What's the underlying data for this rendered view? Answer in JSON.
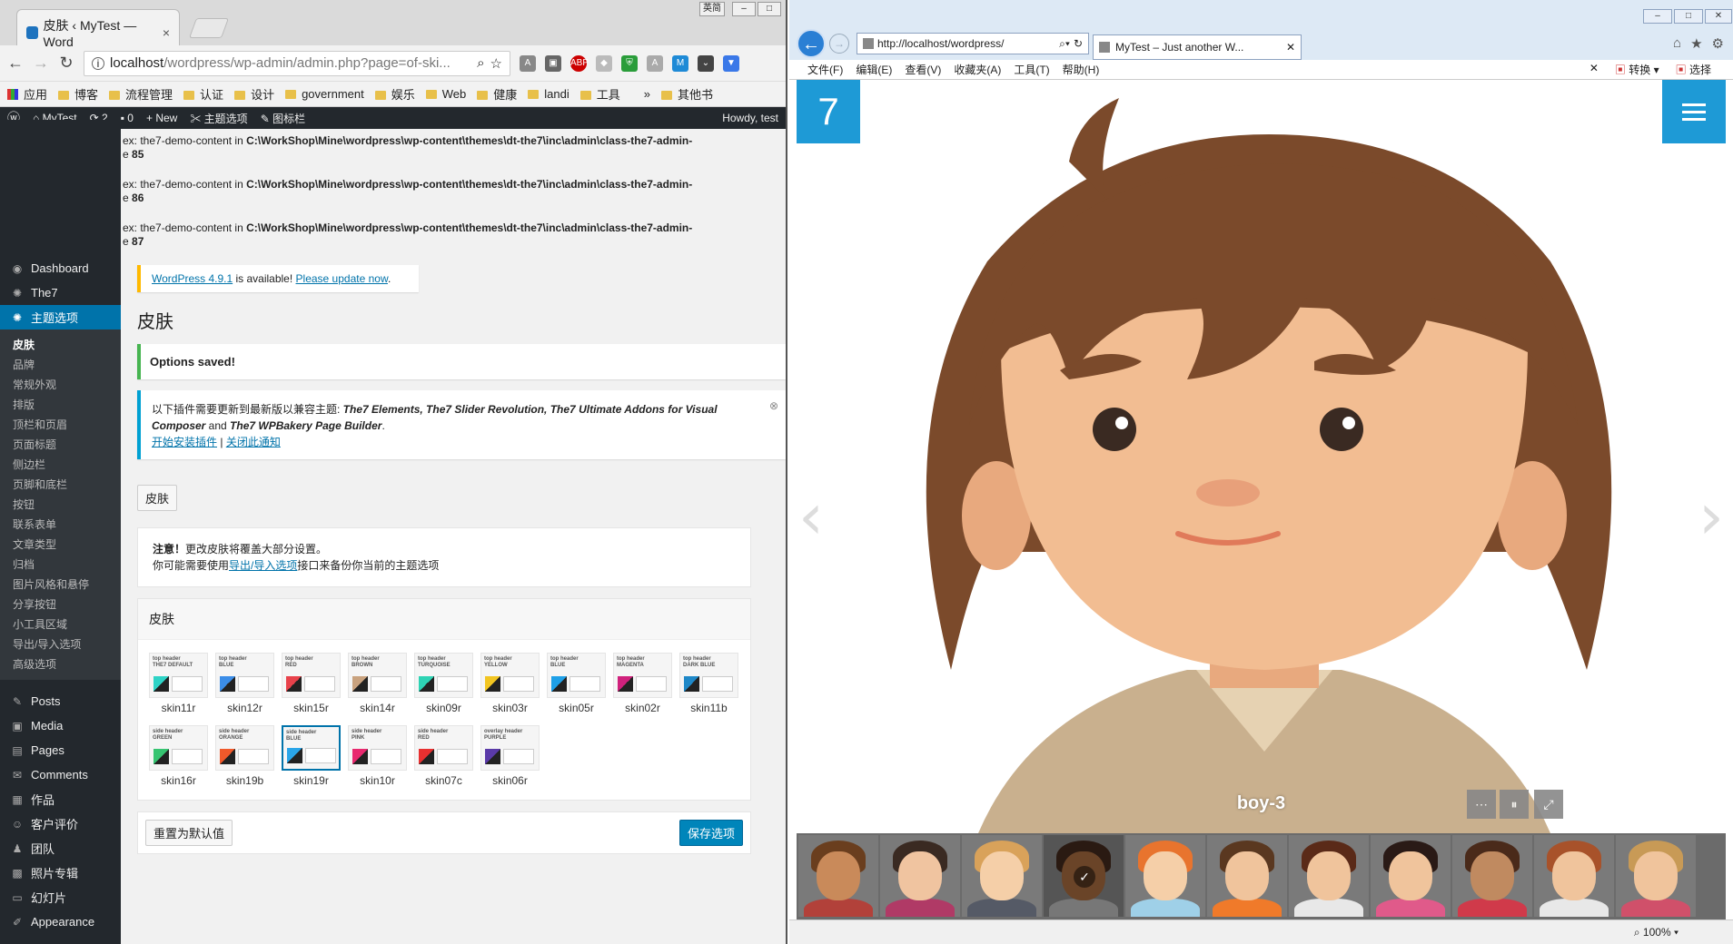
{
  "chrome": {
    "tab_title": "皮肤 ‹ MyTest — Word",
    "url_host": "localhost",
    "url_path": "/wordpress/wp-admin/admin.php?page=of-ski...",
    "ime": "英简",
    "bookmarks": [
      "应用",
      "博客",
      "流程管理",
      "认证",
      "设计",
      "government",
      "娱乐",
      "Web",
      "健康",
      "landi",
      "工具",
      "其他书"
    ],
    "more": "»"
  },
  "adminbar": {
    "site": "MyTest",
    "updates": "2",
    "comments": "0",
    "new": "New",
    "theme_options": "主题选项",
    "iconbar": "图标栏",
    "howdy": "Howdy, test"
  },
  "sidebar": {
    "top": [
      {
        "icon": "◉",
        "label": "Dashboard"
      },
      {
        "icon": "✺",
        "label": "The7"
      },
      {
        "icon": "✺",
        "label": "主题选项"
      }
    ],
    "sub": [
      "皮肤",
      "品牌",
      "常规外观",
      "排版",
      "顶栏和页眉",
      "页面标题",
      "侧边栏",
      "页脚和底栏",
      "按钮",
      "联系表单",
      "文章类型",
      "归档",
      "图片风格和悬停",
      "分享按钮",
      "小工具区域",
      "导出/导入选项",
      "高级选项"
    ],
    "bottom": [
      {
        "icon": "✎",
        "label": "Posts"
      },
      {
        "icon": "▣",
        "label": "Media"
      },
      {
        "icon": "▤",
        "label": "Pages"
      },
      {
        "icon": "✉",
        "label": "Comments"
      },
      {
        "icon": "▦",
        "label": "作品"
      },
      {
        "icon": "☺",
        "label": "客户评价"
      },
      {
        "icon": "♟",
        "label": "团队"
      },
      {
        "icon": "▩",
        "label": "照片专辑"
      },
      {
        "icon": "▭",
        "label": "幻灯片"
      },
      {
        "icon": "✐",
        "label": "Appearance"
      }
    ]
  },
  "errors": [
    {
      "prefix": "ex: the7-demo-content in ",
      "path": "C:\\WorkShop\\Mine\\wordpress\\wp-content\\themes\\dt-the7\\inc\\admin\\class-the7-admin-",
      "line_prefix": "e ",
      "line": "85"
    },
    {
      "prefix": "ex: the7-demo-content in ",
      "path": "C:\\WorkShop\\Mine\\wordpress\\wp-content\\themes\\dt-the7\\inc\\admin\\class-the7-admin-",
      "line_prefix": "e ",
      "line": "86"
    },
    {
      "prefix": "ex: the7-demo-content in ",
      "path": "C:\\WorkShop\\Mine\\wordpress\\wp-content\\themes\\dt-the7\\inc\\admin\\class-the7-admin-",
      "line_prefix": "e ",
      "line": "87"
    }
  ],
  "update_notice": {
    "version_link": "WordPress 4.9.1",
    "text": " is available! ",
    "update_link": "Please update now",
    "end": "."
  },
  "page_title": "皮肤",
  "saved_notice": "Options saved!",
  "plugin_notice": {
    "intro": "以下插件需要更新到最新版以兼容主题: ",
    "plugins": "The7 Elements, The7 Slider Revolution, The7 Ultimate Addons for Visual Composer",
    "and": " and ",
    "last": "The7 WPBakery Page Builder",
    "end": ".",
    "link1": "开始安装插件",
    "sep": " | ",
    "link2": "关闭此通知"
  },
  "section_button": "皮肤",
  "warning": {
    "bold": "注意！",
    "line1": "更改皮肤将覆盖大部分设置。",
    "line2_pre": "你可能需要使用",
    "line2_link": "导出/导入选项",
    "line2_post": "接口来备份你当前的主题选项"
  },
  "skins_title": "皮肤",
  "skins": [
    {
      "name": "skin11r",
      "t1": "top header",
      "t2": "THE7 DEFAULT",
      "color": "#2ed3c6",
      "selected": false
    },
    {
      "name": "skin12r",
      "t1": "top header",
      "t2": "BLUE",
      "color": "#3b8de8",
      "selected": false
    },
    {
      "name": "skin15r",
      "t1": "top header",
      "t2": "RED",
      "color": "#e8424b",
      "selected": false
    },
    {
      "name": "skin14r",
      "t1": "top header",
      "t2": "BROWN",
      "color": "#c9a27e",
      "selected": false
    },
    {
      "name": "skin09r",
      "t1": "top header",
      "t2": "TURQUOISE",
      "color": "#2ed3b4",
      "selected": false
    },
    {
      "name": "skin03r",
      "t1": "top header",
      "t2": "YELLOW",
      "color": "#f2c521",
      "selected": false
    },
    {
      "name": "skin05r",
      "t1": "top header",
      "t2": "BLUE",
      "color": "#1ea0e8",
      "selected": false
    },
    {
      "name": "skin02r",
      "t1": "top header",
      "t2": "MAGENTA",
      "color": "#d0217c",
      "selected": false
    },
    {
      "name": "skin11b",
      "t1": "top header",
      "t2": "DARK BLUE",
      "color": "#1e88c8",
      "selected": false
    },
    {
      "name": "skin16r",
      "t1": "side header",
      "t2": "GREEN",
      "color": "#36c471",
      "selected": false
    },
    {
      "name": "skin19b",
      "t1": "side header",
      "t2": "ORANGE",
      "color": "#f0592a",
      "selected": false
    },
    {
      "name": "skin19r",
      "t1": "side header",
      "t2": "BLUE",
      "color": "#2aa5e8",
      "selected": true
    },
    {
      "name": "skin10r",
      "t1": "side header",
      "t2": "PINK",
      "color": "#e8286e",
      "selected": false
    },
    {
      "name": "skin07c",
      "t1": "side header",
      "t2": "RED",
      "color": "#e83030",
      "selected": false
    },
    {
      "name": "skin06r",
      "t1": "overlay header",
      "t2": "PURPLE",
      "color": "#5a3aa8",
      "selected": false
    }
  ],
  "reset_button": "重置为默认值",
  "save_button": "保存选项",
  "ie": {
    "url": "http://localhost/wordpress/",
    "tab": "MyTest – Just another W...",
    "menu": [
      "文件(F)",
      "编辑(E)",
      "查看(V)",
      "收藏夹(A)",
      "工具(T)",
      "帮助(H)"
    ],
    "convert": "转换",
    "select": "选择",
    "zoom": "100%"
  },
  "gallery": {
    "logo": "7",
    "caption": "boy-3",
    "thumbs": [
      {
        "hair": "#6a3e1e",
        "face": "#c98a5a",
        "body": "#b2413a",
        "active": false
      },
      {
        "hair": "#3a2a22",
        "face": "#f0c4a0",
        "body": "#b03a66",
        "active": false
      },
      {
        "hair": "#d9a25a",
        "face": "#f5cfa8",
        "body": "#555a66",
        "active": false
      },
      {
        "hair": "#2a1a12",
        "face": "#6a4428",
        "body": "#777",
        "active": true
      },
      {
        "hair": "#e8742e",
        "face": "#f5cfa8",
        "body": "#9fd0e8",
        "active": false
      },
      {
        "hair": "#5a3820",
        "face": "#f0c49c",
        "body": "#f07a2a",
        "active": false
      },
      {
        "hair": "#5a2a18",
        "face": "#f0c49c",
        "body": "#e8e8e8",
        "active": false
      },
      {
        "hair": "#2a1a16",
        "face": "#f0c49c",
        "body": "#e05a8a",
        "active": false
      },
      {
        "hair": "#4a2a1a",
        "face": "#c08a60",
        "body": "#d03a4a",
        "active": false
      },
      {
        "hair": "#a8522a",
        "face": "#f0c49c",
        "body": "#e8e8e8",
        "active": false
      },
      {
        "hair": "#c89a56",
        "face": "#f0c49c",
        "body": "#d0506a",
        "active": false
      }
    ]
  }
}
